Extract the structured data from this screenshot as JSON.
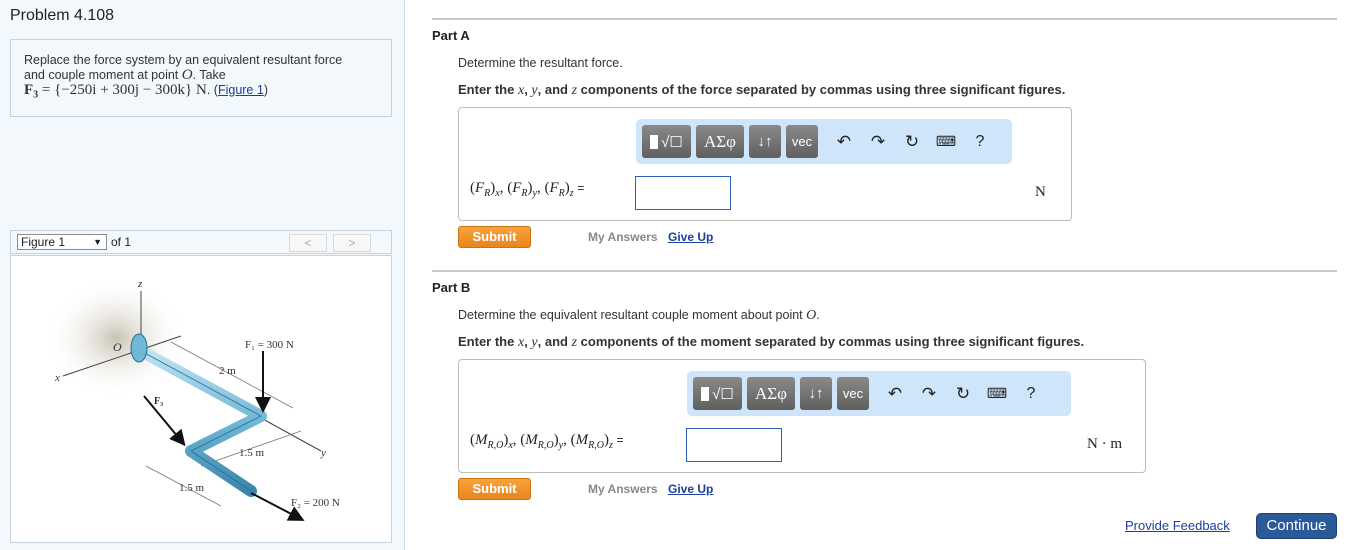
{
  "problem": {
    "title": "Problem 4.108",
    "statement_line1": "Replace the force system by an equivalent resultant force",
    "statement_line2_prefix": "and couple moment at point ",
    "point": "O",
    "statement_line2_suffix": ". Take",
    "force_label": "F",
    "force_sub": "3",
    "force_value": " = {−250i + 300j − 300k} N",
    "figure_link": "Figure 1",
    "figure_link_open": "(",
    "figure_link_close": ")"
  },
  "figure_nav": {
    "selected": "Figure 1",
    "of_label": "of 1",
    "prev_icon": "<",
    "next_icon": ">"
  },
  "figure": {
    "axis_x": "x",
    "axis_y": "y",
    "axis_z": "z",
    "origin": "O",
    "f1_label": "F₁ = 300 N",
    "f2_label": "F₂ = 200 N",
    "f3_label": "F₃",
    "dim_2m": "2 m",
    "dim_15m_a": "1.5 m",
    "dim_15m_b": "1.5 m"
  },
  "parts": [
    {
      "title": "Part A",
      "prompt": "Determine the resultant force.",
      "instruction_pre": "Enter the ",
      "instruction_post": " components of the force separated by commas using three significant figures.",
      "var_x": "x",
      "var_y": "y",
      "var_z": "z",
      "sep1": ", ",
      "sep2": ", and ",
      "toolbar": [
        "templates",
        "ΑΣφ",
        "↓↑",
        "vec"
      ],
      "eq_symbol": "F",
      "eq_sub": "R",
      "answer_value": "",
      "unit": "N",
      "submit_label": "Submit",
      "my_answers_label": "My Answers",
      "give_up_label": "Give Up"
    },
    {
      "title": "Part B",
      "prompt_pre": "Determine the equivalent resultant couple moment about point ",
      "prompt_point": "O",
      "prompt_post": ".",
      "instruction_pre": "Enter the ",
      "instruction_post": " components of the moment separated by commas using three significant figures.",
      "var_x": "x",
      "var_y": "y",
      "var_z": "z",
      "sep1": ", ",
      "sep2": ", and ",
      "toolbar": [
        "templates",
        "ΑΣφ",
        "↓↑",
        "vec"
      ],
      "eq_symbol": "M",
      "eq_sub": "R,O",
      "answer_value": "",
      "unit": "N · m",
      "submit_label": "Submit",
      "my_answers_label": "My Answers",
      "give_up_label": "Give Up"
    }
  ],
  "toolbar_icons": {
    "undo": "undo-icon",
    "redo": "redo-icon",
    "reset": "reset-icon",
    "keyboard": "keyboard-icon",
    "help": "?"
  },
  "footer": {
    "feedback_label": "Provide Feedback",
    "continue_label": "Continue"
  },
  "colors": {
    "submit": "#e9851c",
    "continue": "#2a5a9a",
    "link": "#1a3f9e",
    "toolbar_bg": "#cfe5fa"
  }
}
